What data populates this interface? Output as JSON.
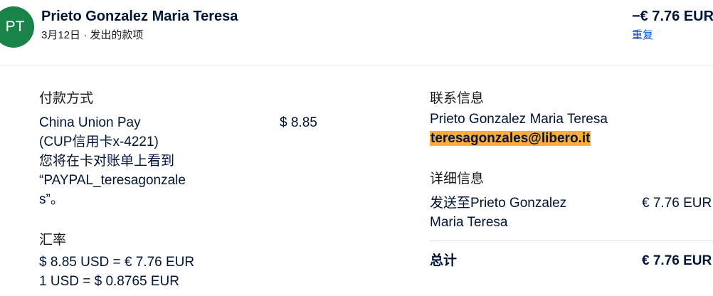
{
  "header": {
    "avatar_initials": "PT",
    "name": "Prieto Gonzalez Maria Teresa",
    "subtitle": "3月12日 · 发出的款项",
    "amount": "−€ 7.76 EUR",
    "repeat_label": "重复"
  },
  "payment": {
    "title": "付款方式",
    "method_lines": [
      "China Union Pay",
      "(CUP信用卡x-4221)",
      "您将在卡对账单上看到",
      "“PAYPAL_teresagonzale",
      "s”。"
    ],
    "amount": "$ 8.85"
  },
  "exchange": {
    "title": "汇率",
    "line1": "$ 8.85 USD = € 7.76 EUR",
    "line2": "1 USD = $ 0.8765 EUR"
  },
  "contact": {
    "title": "联系信息",
    "name": "Prieto Gonzalez Maria Teresa",
    "email": "teresagonzales@libero.it"
  },
  "details": {
    "title": "详细信息",
    "line1": "发送至Prieto Gonzalez",
    "line2": "Maria Teresa",
    "amount": "€ 7.76 EUR"
  },
  "total": {
    "label": "总计",
    "amount": "€ 7.76 EUR"
  },
  "colors": {
    "avatar_bg": "#1a8348",
    "link": "#0055d4",
    "highlight": "#fcac3a",
    "text": "#001435"
  }
}
